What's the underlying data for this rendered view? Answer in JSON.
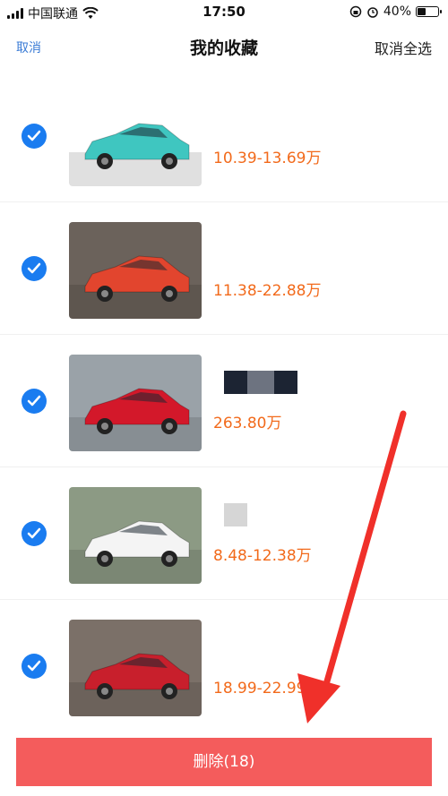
{
  "status_bar": {
    "carrier": "中国联通",
    "time": "17:50",
    "battery": "40%"
  },
  "nav": {
    "cancel": "取消",
    "title": "我的收藏",
    "deselect_all": "取消全选"
  },
  "items": [
    {
      "price": "10.39-13.69万",
      "car_color": "#3fc6c0",
      "bg": "#ffffff",
      "checked": true
    },
    {
      "price": "11.38-22.88万",
      "car_color": "#e2452e",
      "bg": "#6b625b",
      "checked": true
    },
    {
      "price": "263.80万",
      "car_color": "#d3182a",
      "bg": "#9aa2a8",
      "checked": true
    },
    {
      "price": "8.48-12.38万",
      "car_color": "#f4f4f4",
      "bg": "#8c9a84",
      "checked": true
    },
    {
      "price": "18.99-22.99万",
      "car_color": "#c81f2c",
      "bg": "#7b7068",
      "checked": true
    }
  ],
  "footer": {
    "delete_label": "删除(18)"
  },
  "colors": {
    "accent": "#1a7cf0",
    "price": "#f26a1b",
    "delete": "#f45c5c",
    "arrow": "#f0302a"
  }
}
